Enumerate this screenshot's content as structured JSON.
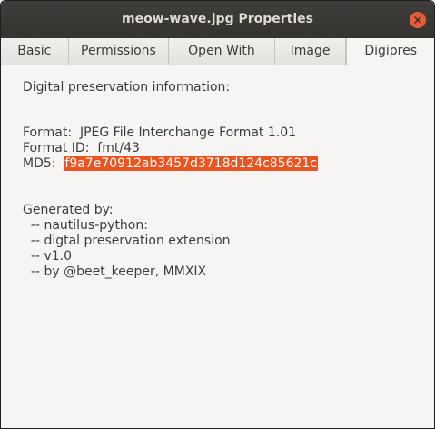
{
  "window": {
    "title": "meow-wave.jpg Properties"
  },
  "tabs": [
    {
      "label": "Basic"
    },
    {
      "label": "Permissions"
    },
    {
      "label": "Open With"
    },
    {
      "label": "Image"
    },
    {
      "label": "Digipres"
    }
  ],
  "active_tab": "Digipres",
  "content": {
    "heading": "Digital preservation information:",
    "format_line": "Format:  JPEG File Interchange Format 1.01",
    "format_id_line": "Format ID:  fmt/43",
    "md5_label": "MD5:  ",
    "md5_value": "f9a7e70912ab3457d3718d124c85621c",
    "generated_by": "Generated by:",
    "credits": [
      "  -- nautilus-python:",
      "  -- digtal preservation extension",
      "  -- v1.0",
      "  -- by @beet_keeper, MMXIX"
    ]
  },
  "colors": {
    "selection": "#e95420",
    "close_button": "#e35e3a",
    "titlebar": "#3a3936"
  },
  "icons": {
    "close": "close-icon"
  }
}
